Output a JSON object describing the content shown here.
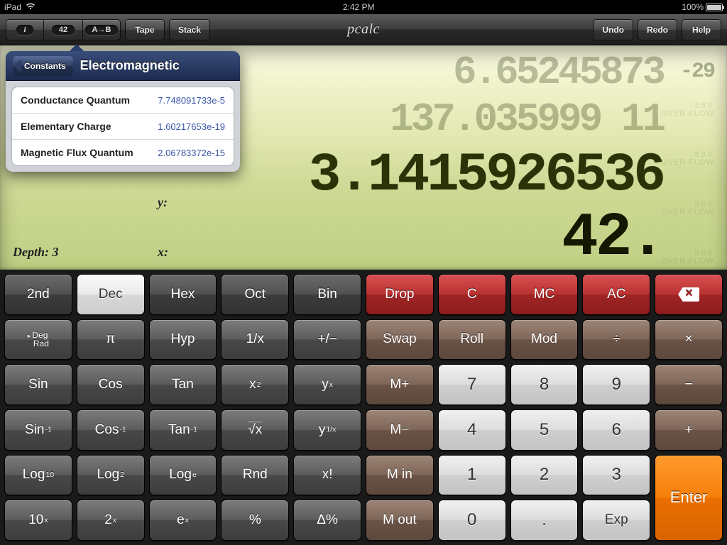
{
  "status": {
    "device": "iPad",
    "time": "2:42 PM",
    "battery_pct": "100%"
  },
  "toolbar": {
    "info_label": "i",
    "const_badge": "42",
    "convert_label": "A→B",
    "tape": "Tape",
    "stack": "Stack",
    "title": "pcalc",
    "undo": "Undo",
    "redo": "Redo",
    "help": "Help"
  },
  "popover": {
    "back": "Constants",
    "title": "Electromagnetic",
    "rows": [
      {
        "name": "Conductance Quantum",
        "val": "7.748091733e-5"
      },
      {
        "name": "Elementary Charge",
        "val": "1.60217653e-19"
      },
      {
        "name": "Magnetic Flux Quantum",
        "val": "2.06783372e-15"
      }
    ]
  },
  "display": {
    "line1": "6.65245873",
    "exp1": "-29",
    "line2": "137.035999 11",
    "line3": "3.1415926536",
    "line4": "42.",
    "depth_label": "Depth: 3",
    "x": "x:",
    "y": "y:",
    "ghost_digits": "-888",
    "overflow": "OVER\nFLOW"
  },
  "keys": {
    "second": "2nd",
    "dec": "Dec",
    "hex": "Hex",
    "oct": "Oct",
    "bin": "Bin",
    "drop": "Drop",
    "c": "C",
    "mc": "MC",
    "ac": "AC",
    "deg": "Deg",
    "rad": "Rad",
    "pi": "π",
    "hyp": "Hyp",
    "inv": "1/x",
    "pm": "+/−",
    "swap": "Swap",
    "roll": "Roll",
    "mod": "Mod",
    "div": "÷",
    "mul": "×",
    "sin": "Sin",
    "cos": "Cos",
    "tan": "Tan",
    "mp": "M+",
    "minus": "−",
    "mm": "M−",
    "plus": "+",
    "log10": "Log",
    "log2": "Log",
    "loge": "Log",
    "rnd": "Rnd",
    "fact": "x!",
    "min": "M in",
    "tenx": "10",
    "twox": "2",
    "ex": "e",
    "pct": "%",
    "dpct": "Δ%",
    "mout": "M out",
    "dot": ".",
    "exp": "Exp",
    "enter": "Enter",
    "d7": "7",
    "d8": "8",
    "d9": "9",
    "d4": "4",
    "d5": "5",
    "d6": "6",
    "d1": "1",
    "d2": "2",
    "d3": "3",
    "d0": "0"
  }
}
